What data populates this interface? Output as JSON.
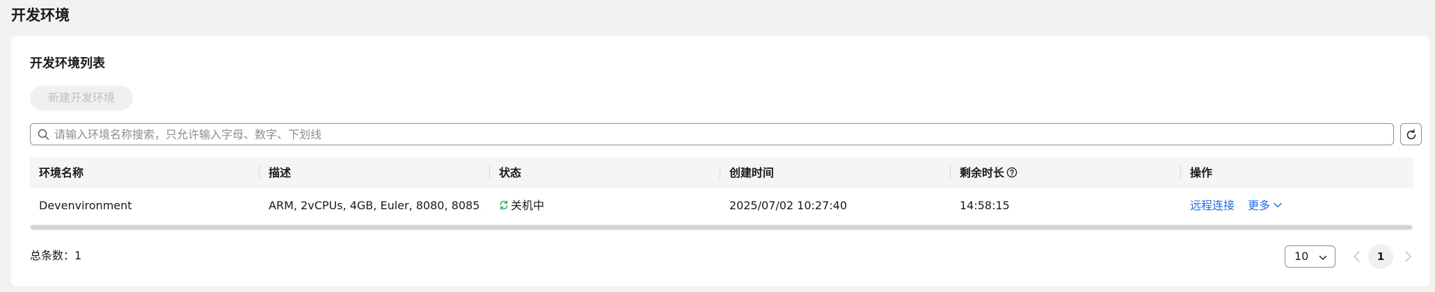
{
  "page": {
    "title": "开发环境"
  },
  "list": {
    "title": "开发环境列表",
    "create_button": "新建开发环境",
    "search_placeholder": "请输入环境名称搜索，只允许输入字母、数字、下划线",
    "columns": [
      "环境名称",
      "描述",
      "状态",
      "创建时间",
      "剩余时长",
      "操作"
    ],
    "rows": [
      {
        "name": "Devenvironment",
        "description": "ARM, 2vCPUs, 4GB, Euler, 8080, 8085, ...",
        "status": "关机中",
        "created": "2025/07/02 10:27:40",
        "remaining": "14:58:15",
        "action_remote": "远程连接",
        "action_more": "更多"
      }
    ]
  },
  "pagination": {
    "total_label": "总条数：1",
    "page_size": "10",
    "current_page": "1"
  },
  "colors": {
    "link": "#1e6ce8",
    "status_icon": "#2fb85e"
  }
}
